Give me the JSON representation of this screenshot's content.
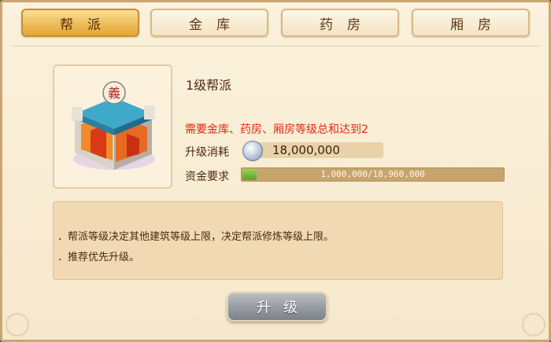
{
  "tabs": [
    {
      "label": "帮派",
      "active": true
    },
    {
      "label": "金库",
      "active": false
    },
    {
      "label": "药房",
      "active": false
    },
    {
      "label": "厢房",
      "active": false
    }
  ],
  "building": {
    "icon": "gang-hall-building-icon",
    "sign_char": "義",
    "level_title": "1级帮派",
    "requirement": "需要金库、药房、厢房等级总和达到2",
    "cost_label": "升级消耗",
    "cost_icon": "silver-coin-icon",
    "cost_value": "18,000,000",
    "fund_label": "资金要求",
    "fund_text": "1,000,000/18,960,000",
    "fund_progress": 0.053
  },
  "description": {
    "lines": [
      "．帮派等级决定其他建筑等级上限，决定帮派修炼等级上限。",
      "．推荐优先升级。"
    ]
  },
  "upgrade_button": {
    "label": "升级"
  },
  "colors": {
    "active_tab": "#eebd59",
    "requirement_text": "#e02a12",
    "progress_fill": "#56a326",
    "button_gray": "#949a9f"
  }
}
